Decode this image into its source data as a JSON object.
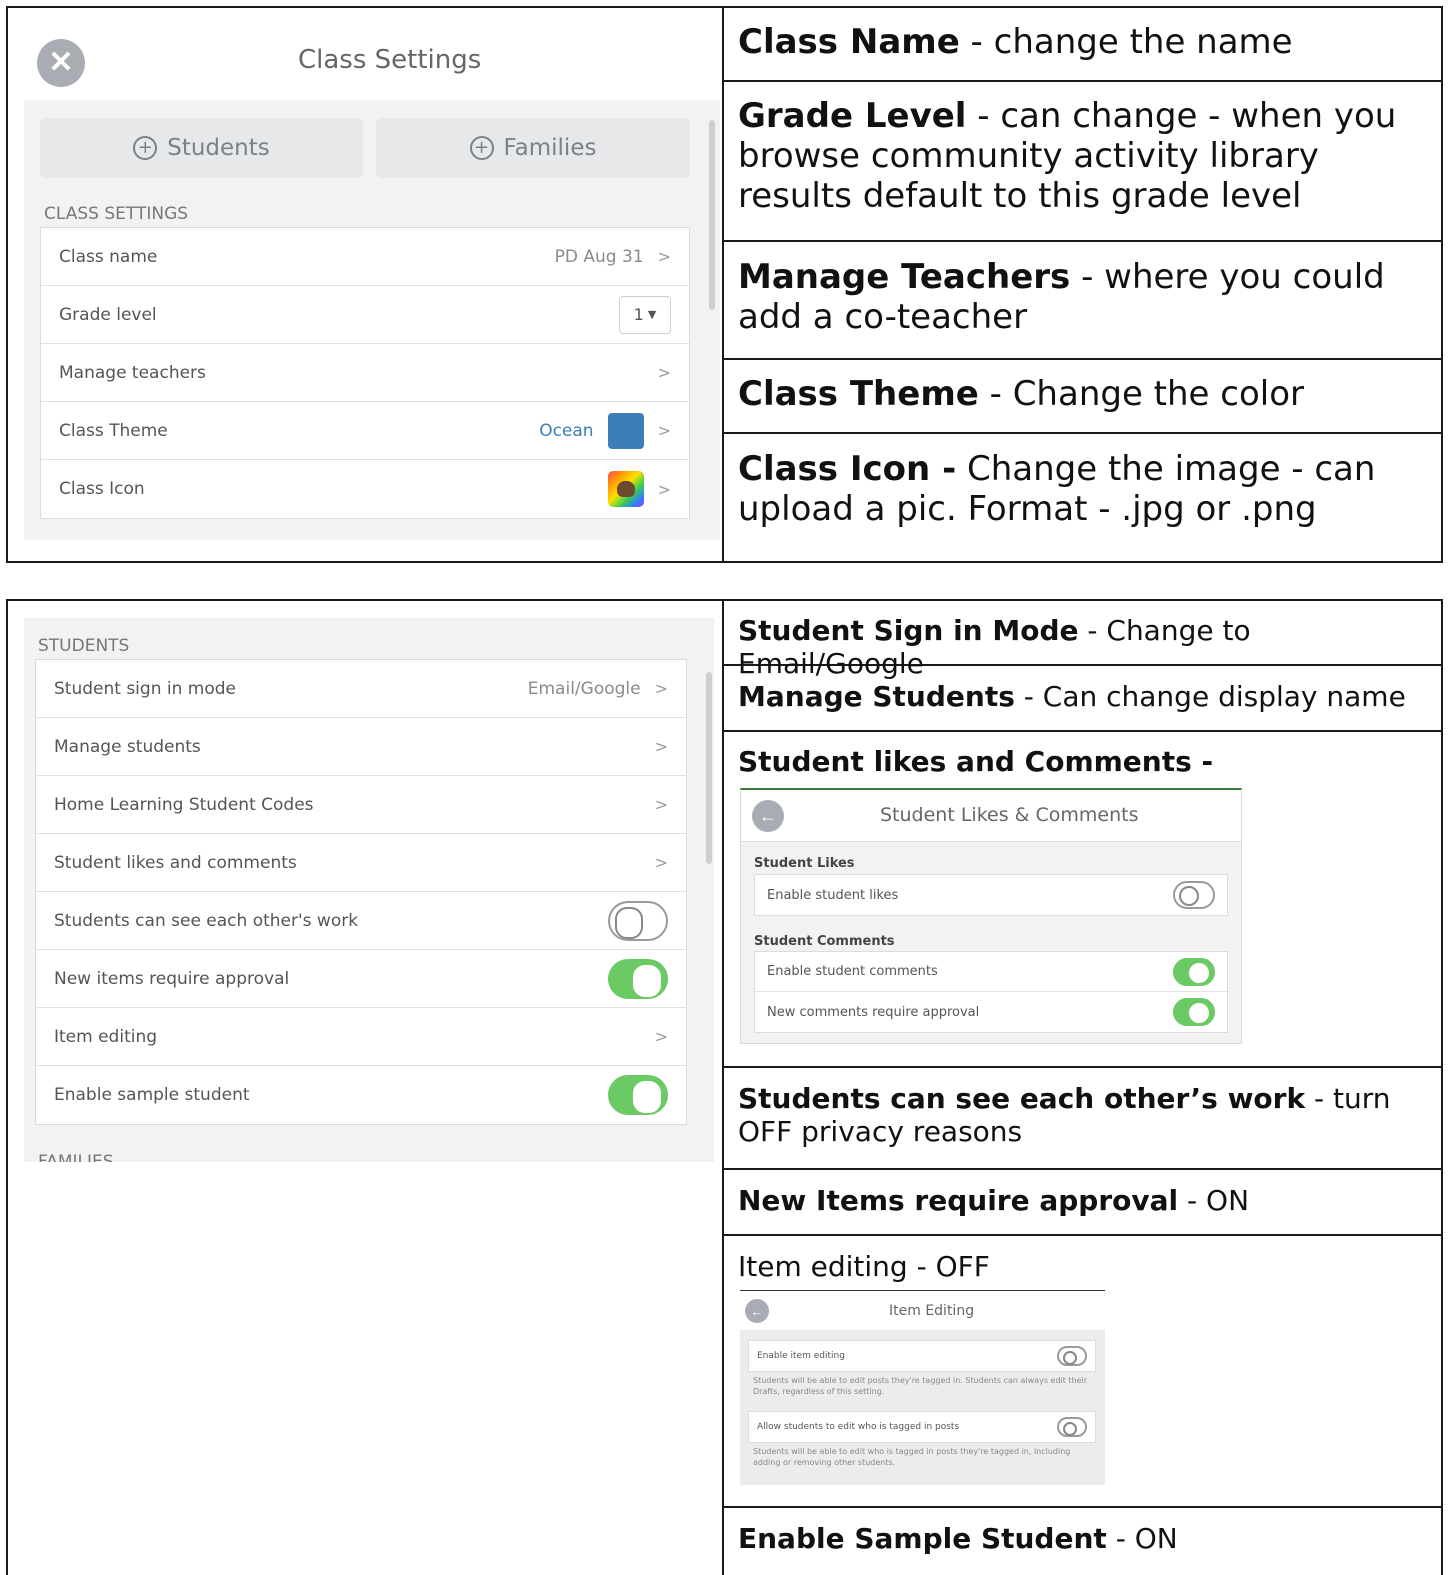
{
  "top": {
    "screenshot": {
      "close_icon": "close-icon",
      "title": "Class Settings",
      "students_button": "Students",
      "families_button": "Families",
      "section_label": "CLASS SETTINGS",
      "rows": [
        {
          "label": "Class name",
          "value": "PD Aug 31",
          "chevron": ">"
        },
        {
          "label": "Grade level",
          "value": "1"
        },
        {
          "label": "Manage teachers",
          "chevron": ">"
        },
        {
          "label": "Class Theme",
          "value": "Ocean",
          "swatch_color": "#3d7db8",
          "chevron": ">"
        },
        {
          "label": "Class Icon",
          "chevron": ">"
        }
      ]
    },
    "descriptions": [
      {
        "term": "Class Name",
        "text": " - change the name"
      },
      {
        "term": "Grade Level",
        "text": " - can change - when you browse community activity library results default to this grade level"
      },
      {
        "term": "Manage Teachers",
        "text": " - where you could add a co-teacher"
      },
      {
        "term": "Class Theme",
        "text": " - Change the color"
      },
      {
        "term": "Class Icon -",
        "text": "  Change the image - can upload a pic. Format - .jpg or .png"
      }
    ]
  },
  "bottom": {
    "screenshot": {
      "section_label": "STUDENTS",
      "rows": [
        {
          "label": "Student sign in mode",
          "value": "Email/Google",
          "chevron": ">"
        },
        {
          "label": "Manage students",
          "chevron": ">"
        },
        {
          "label": "Home Learning Student Codes",
          "chevron": ">"
        },
        {
          "label": "Student likes and comments",
          "chevron": ">"
        },
        {
          "label": "Students can see each other's work",
          "toggle": false
        },
        {
          "label": "New items require approval",
          "toggle": true
        },
        {
          "label": "Item editing",
          "chevron": ">"
        },
        {
          "label": "Enable sample student",
          "toggle": true
        }
      ],
      "next_section_partial": "FAMILIES"
    },
    "descriptions": [
      {
        "term": "Student Sign in Mode",
        "text": " - Change to Email/Google"
      },
      {
        "term": "Manage Students",
        "text": " - Can change display name"
      },
      {
        "term": "Student likes and Comments -",
        "text": ""
      },
      {
        "term": "Students can see each other’s work",
        "text": " - turn OFF privacy reasons"
      },
      {
        "term": "New Items require approval",
        "text": " - ON"
      },
      {
        "term": "",
        "text": "Item editing - OFF"
      },
      {
        "term": "Enable Sample Student",
        "text": " - ON"
      }
    ],
    "likes_comments": {
      "title": "Student Likes & Comments",
      "likes_label": "Student Likes",
      "enable_likes": "Enable student likes",
      "likes_on": false,
      "comments_label": "Student Comments",
      "enable_comments": "Enable student comments",
      "comments_on": true,
      "comments_approval": "New comments require approval",
      "approval_on": true
    },
    "item_editing": {
      "title": "Item Editing",
      "enable_item_editing": "Enable item editing",
      "enable_note": "Students will be able to edit posts they're tagged in. Students can always edit their Drafts, regardless of this setting.",
      "allow_tagging": "Allow students to edit who is tagged in posts",
      "allow_note": "Students will be able to edit who is tagged in posts they're tagged in, including adding or removing other students."
    }
  }
}
